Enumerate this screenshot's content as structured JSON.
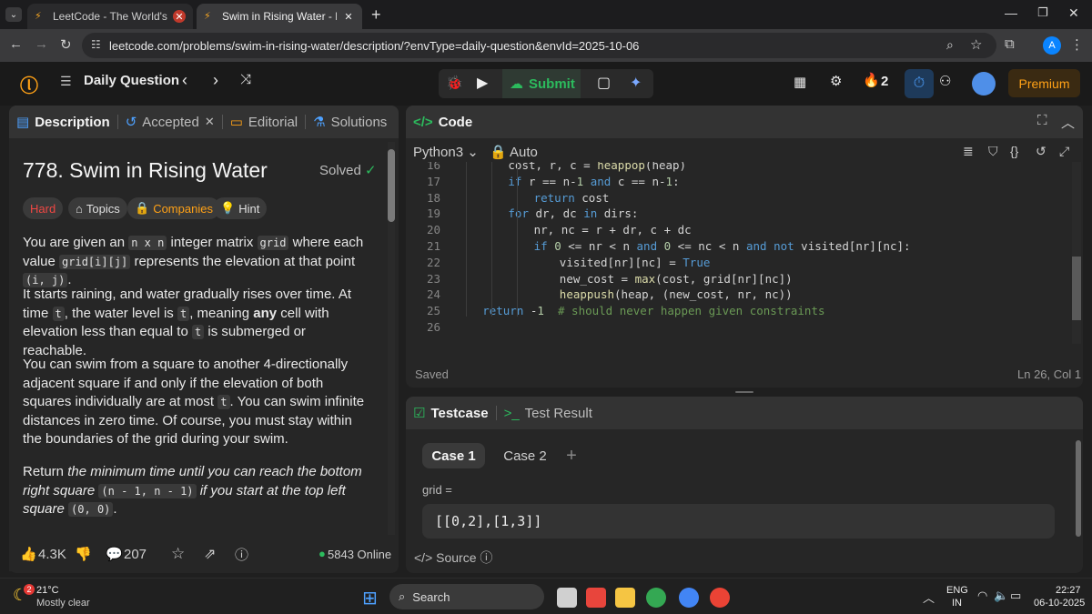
{
  "browser": {
    "tabs": [
      {
        "title": "LeetCode - The World's Leading"
      },
      {
        "title": "Swim in Rising Water - LeetCod"
      }
    ],
    "url": "leetcode.com/problems/swim-in-rising-water/description/?envType=daily-question&envId=2025-10-06",
    "profile_initial": "A"
  },
  "header": {
    "daily_label": "Daily Question",
    "submit_label": "Submit",
    "streak_count": "2",
    "premium_label": "Premium"
  },
  "left": {
    "tabs": [
      "Description",
      "Accepted",
      "Editorial",
      "Solutions"
    ],
    "title": "778. Swim in Rising Water",
    "status": "Solved",
    "pills": [
      "Hard",
      "Topics",
      "Companies",
      "Hint"
    ],
    "p1": [
      "You are given an ",
      "n x n",
      " integer matrix ",
      "grid",
      " where each value ",
      "grid[i][j]",
      " represents the elevation at that point ",
      "(i, j)",
      "."
    ],
    "p2": [
      "It starts raining, and water gradually rises over time. At time ",
      "t",
      ", the water level is ",
      "t",
      ", meaning ",
      "any",
      " cell with elevation less than equal to ",
      "t",
      " is submerged or reachable."
    ],
    "p3": [
      "You can swim from a square to another 4-directionally adjacent square if and only if the elevation of both squares individually are at most ",
      "t",
      ". You can swim infinite distances in zero time. Of course, you must stay within the boundaries of the grid during your swim."
    ],
    "p4": [
      "Return ",
      "the minimum time until you can reach the bottom right square ",
      "(n - 1, n - 1)",
      " if you start at the top left square ",
      "(0, 0)",
      "."
    ],
    "footer": {
      "likes": "4.3K",
      "comments": "207",
      "online": "5843 Online"
    }
  },
  "code": {
    "title": "Code",
    "language": "Python3",
    "mode": "Auto",
    "status": "Saved",
    "cursor": "Ln 26, Col 1",
    "lines": [
      {
        "n": "16",
        "indent": 8,
        "t": "cost, r, c = heappop(heap)"
      },
      {
        "n": "17",
        "indent": 8,
        "t": "if r == n-1 and c == n-1:"
      },
      {
        "n": "18",
        "indent": 12,
        "t": "return cost"
      },
      {
        "n": "19",
        "indent": 8,
        "t": "for dr, dc in dirs:"
      },
      {
        "n": "20",
        "indent": 12,
        "t": "nr, nc = r + dr, c + dc"
      },
      {
        "n": "21",
        "indent": 12,
        "t": "if 0 <= nr < n and 0 <= nc < n and not visited[nr][nc]:"
      },
      {
        "n": "22",
        "indent": 16,
        "t": "visited[nr][nc] = True"
      },
      {
        "n": "23",
        "indent": 16,
        "t": "new_cost = max(cost, grid[nr][nc])"
      },
      {
        "n": "24",
        "indent": 16,
        "t": "heappush(heap, (new_cost, nr, nc))"
      },
      {
        "n": "25",
        "indent": 4,
        "t": "return -1  # should never happen given constraints"
      },
      {
        "n": "26",
        "indent": 0,
        "t": ""
      }
    ]
  },
  "testcase": {
    "tabs": [
      "Testcase",
      "Test Result"
    ],
    "cases": [
      "Case 1",
      "Case 2"
    ],
    "param_label": "grid =",
    "param_value": "[[0,2],[1,3]]",
    "source_label": "Source"
  },
  "taskbar": {
    "temp": "21°C",
    "weather": "Mostly clear",
    "weather_badge": "2",
    "search": "Search",
    "lang": "ENG",
    "region": "IN",
    "time": "22:27",
    "date": "06-10-2025"
  },
  "colors": {
    "accent": "#ffa116",
    "green": "#2cbb5d",
    "hard": "#ef4743",
    "blue": "#0a84ff"
  }
}
